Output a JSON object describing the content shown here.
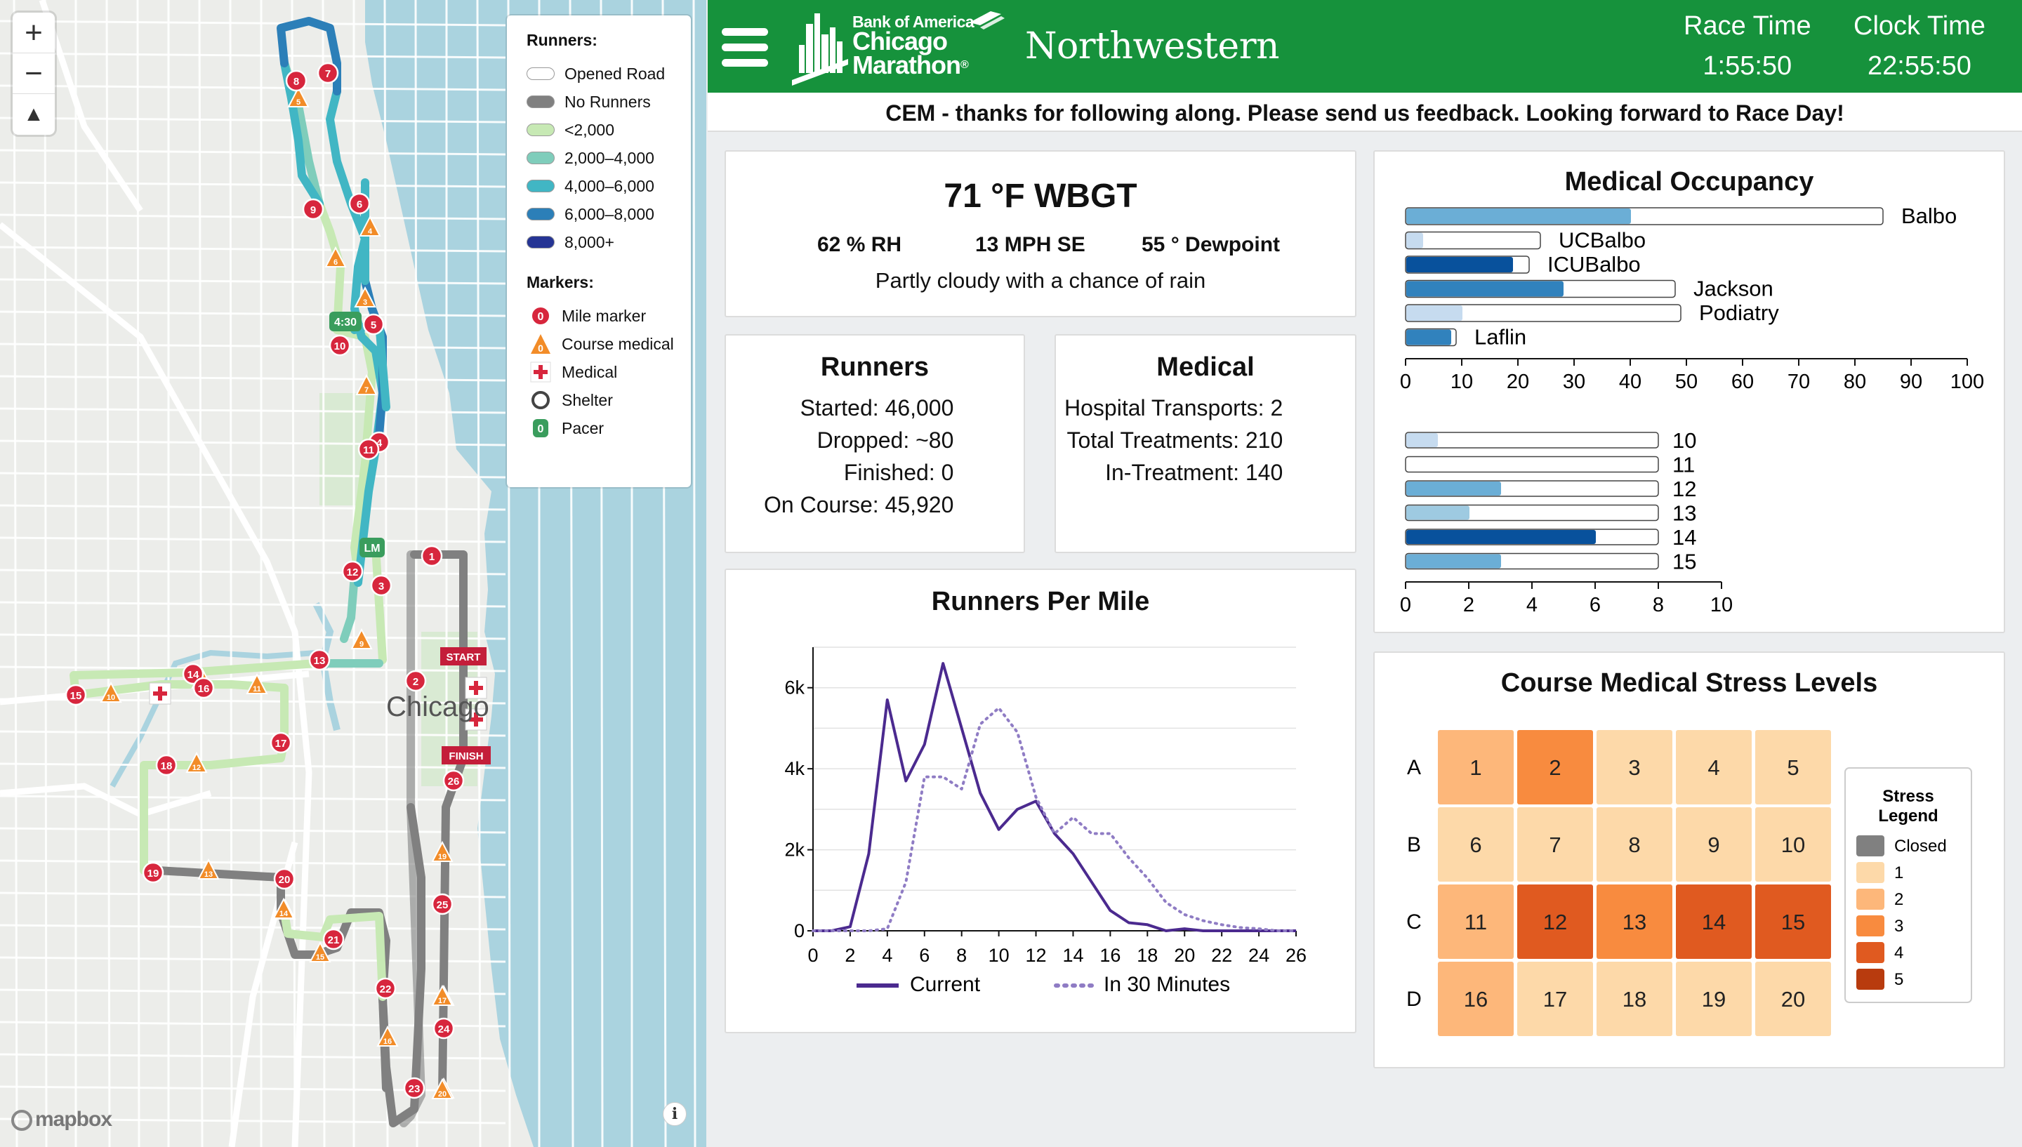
{
  "header": {
    "menu_icon": "hamburger-menu-icon",
    "logo_line1": "Bank of America",
    "logo_line2": "Chicago",
    "logo_line3": "Marathon",
    "logo_tm": "®",
    "sponsor": "Northwestern",
    "race_time_label": "Race Time",
    "race_time": "1:55:50",
    "clock_time_label": "Clock Time",
    "clock_time": "22:55:50"
  },
  "banner": "CEM - thanks for following along. Please send us feedback. Looking forward to Race Day!",
  "map": {
    "zoom_in": "+",
    "zoom_out": "−",
    "compass": "▲",
    "city_label": "Chicago",
    "start_label": "START",
    "finish_label": "FINISH",
    "pace_label_430": "4:30",
    "pace_label_lm": "LM",
    "attribution": "mapbox",
    "info": "i",
    "legend": {
      "runners_title": "Runners:",
      "runner_items": [
        {
          "label": "Opened Road",
          "color": "#ffffff"
        },
        {
          "label": "No Runners",
          "color": "#808080"
        },
        {
          "label": "<2,000",
          "color": "#c7e9b4"
        },
        {
          "label": "2,000–4,000",
          "color": "#7fcdbb"
        },
        {
          "label": "4,000–6,000",
          "color": "#41b6c4"
        },
        {
          "label": "6,000–8,000",
          "color": "#2c7fb8"
        },
        {
          "label": "8,000+",
          "color": "#253494"
        }
      ],
      "markers_title": "Markers:",
      "marker_items": [
        {
          "label": "Mile marker",
          "icon": "mile-marker-icon",
          "glyph": "0"
        },
        {
          "label": "Course medical",
          "icon": "course-medical-icon",
          "glyph": "0"
        },
        {
          "label": "Medical",
          "icon": "medical-cross-icon",
          "glyph": "+"
        },
        {
          "label": "Shelter",
          "icon": "shelter-icon",
          "glyph": ""
        },
        {
          "label": "Pacer",
          "icon": "pacer-icon",
          "glyph": "0"
        }
      ]
    },
    "mile_markers": [
      "1",
      "2",
      "3",
      "4",
      "5",
      "6",
      "7",
      "8",
      "9",
      "10",
      "11",
      "12",
      "13",
      "14",
      "15",
      "16",
      "17",
      "18",
      "19",
      "20",
      "21",
      "22",
      "23",
      "24",
      "25",
      "26"
    ],
    "course_medical_markers": [
      "1",
      "2",
      "3",
      "4",
      "5",
      "6",
      "7",
      "8",
      "9",
      "10",
      "11",
      "12",
      "13",
      "14",
      "15",
      "16",
      "17",
      "18",
      "19",
      "20"
    ]
  },
  "weather": {
    "headline": "71 °F WBGT",
    "humidity": "62 % RH",
    "wind": "13 MPH SE",
    "dewpoint": "55 ° Dewpoint",
    "description": "Partly cloudy with a chance of rain"
  },
  "runners": {
    "title": "Runners",
    "rows": [
      {
        "label": "Started:",
        "value": "46,000"
      },
      {
        "label": "Dropped:",
        "value": "~80"
      },
      {
        "label": "Finished:",
        "value": "0"
      },
      {
        "label": "On Course:",
        "value": "45,920"
      }
    ]
  },
  "medical": {
    "title": "Medical",
    "rows": [
      {
        "label": "Hospital Transports:",
        "value": "2"
      },
      {
        "label": "Total Treatments:",
        "value": "210"
      },
      {
        "label": "In-Treatment:",
        "value": "140"
      }
    ]
  },
  "occupancy": {
    "title": "Medical Occupancy",
    "axis_ticks": [
      "0",
      "10",
      "20",
      "30",
      "40",
      "50",
      "60",
      "70",
      "80",
      "90",
      "100"
    ],
    "facilities": [
      {
        "name": "Balbo",
        "occupied": 40,
        "capacity": 85,
        "color": "#6baed6"
      },
      {
        "name": "UCBalbo",
        "occupied": 3,
        "capacity": 24,
        "color": "#c6dbef"
      },
      {
        "name": "ICUBalbo",
        "occupied": 19,
        "capacity": 22,
        "color": "#08519c"
      },
      {
        "name": "Jackson",
        "occupied": 28,
        "capacity": 48,
        "color": "#3182bd"
      },
      {
        "name": "Podiatry",
        "occupied": 10,
        "capacity": 49,
        "color": "#c6dbef"
      },
      {
        "name": "Laflin",
        "occupied": 8,
        "capacity": 9,
        "color": "#3182bd"
      }
    ],
    "tent_axis_ticks": [
      "0",
      "2",
      "4",
      "6",
      "8",
      "10"
    ],
    "tents": [
      {
        "name": "10",
        "occupied": 1,
        "capacity": 8,
        "color": "#c6dbef"
      },
      {
        "name": "11",
        "occupied": 0,
        "capacity": 8,
        "color": "#ffffff"
      },
      {
        "name": "12",
        "occupied": 3,
        "capacity": 8,
        "color": "#6baed6"
      },
      {
        "name": "13",
        "occupied": 2,
        "capacity": 8,
        "color": "#9ecae1"
      },
      {
        "name": "14",
        "occupied": 6,
        "capacity": 8,
        "color": "#08519c"
      },
      {
        "name": "15",
        "occupied": 3,
        "capacity": 8,
        "color": "#6baed6"
      }
    ]
  },
  "chart_data": {
    "type": "line",
    "title": "Runners Per Mile",
    "xlabel": "",
    "ylabel": "",
    "xlim": [
      0,
      26
    ],
    "ylim": [
      0,
      7000
    ],
    "x_ticks": [
      "0",
      "2",
      "4",
      "6",
      "8",
      "10",
      "12",
      "14",
      "16",
      "18",
      "20",
      "22",
      "24",
      "26"
    ],
    "y_ticks": [
      "0",
      "2k",
      "4k",
      "6k"
    ],
    "grid": true,
    "legend_position": "bottom",
    "series": [
      {
        "name": "Current",
        "style": "solid",
        "color": "#4b2a8f",
        "x": [
          0,
          1,
          2,
          3,
          4,
          5,
          6,
          7,
          8,
          9,
          10,
          11,
          12,
          13,
          14,
          15,
          16,
          17,
          18,
          19,
          20,
          21,
          22,
          23,
          24,
          25,
          26
        ],
        "y": [
          0,
          0,
          100,
          1900,
          5700,
          3700,
          4600,
          6600,
          5000,
          3400,
          2500,
          3000,
          3200,
          2400,
          1900,
          1200,
          500,
          200,
          150,
          0,
          50,
          0,
          0,
          0,
          0,
          0,
          0
        ]
      },
      {
        "name": "In 30 Minutes",
        "style": "dotted",
        "color": "#8f7cc4",
        "x": [
          0,
          1,
          2,
          3,
          4,
          5,
          6,
          7,
          8,
          9,
          10,
          11,
          12,
          13,
          14,
          15,
          16,
          17,
          18,
          19,
          20,
          21,
          22,
          23,
          24,
          25,
          26
        ],
        "y": [
          0,
          0,
          0,
          0,
          50,
          1200,
          3800,
          3800,
          3500,
          5100,
          5500,
          4900,
          3300,
          2400,
          2800,
          2400,
          2400,
          1800,
          1300,
          700,
          400,
          250,
          150,
          80,
          50,
          0,
          0
        ]
      }
    ]
  },
  "stress": {
    "title": "Course Medical Stress Levels",
    "rows": [
      "A",
      "B",
      "C",
      "D"
    ],
    "cells": [
      {
        "id": "1",
        "level": 2
      },
      {
        "id": "2",
        "level": 3
      },
      {
        "id": "3",
        "level": 1
      },
      {
        "id": "4",
        "level": 1
      },
      {
        "id": "5",
        "level": 1
      },
      {
        "id": "6",
        "level": 1
      },
      {
        "id": "7",
        "level": 1
      },
      {
        "id": "8",
        "level": 1
      },
      {
        "id": "9",
        "level": 1
      },
      {
        "id": "10",
        "level": 1
      },
      {
        "id": "11",
        "level": 2
      },
      {
        "id": "12",
        "level": 4
      },
      {
        "id": "13",
        "level": 3
      },
      {
        "id": "14",
        "level": 4
      },
      {
        "id": "15",
        "level": 4
      },
      {
        "id": "16",
        "level": 2
      },
      {
        "id": "17",
        "level": 1
      },
      {
        "id": "18",
        "level": 1
      },
      {
        "id": "19",
        "level": 1
      },
      {
        "id": "20",
        "level": 1
      }
    ],
    "legend_title_1": "Stress",
    "legend_title_2": "Legend",
    "legend": [
      {
        "label": "Closed",
        "color": "#808080"
      },
      {
        "label": "1",
        "color": "#fdd9a9"
      },
      {
        "label": "2",
        "color": "#fdb77a"
      },
      {
        "label": "3",
        "color": "#f88b3f"
      },
      {
        "label": "4",
        "color": "#e05a20"
      },
      {
        "label": "5",
        "color": "#b83b0e"
      }
    ]
  }
}
